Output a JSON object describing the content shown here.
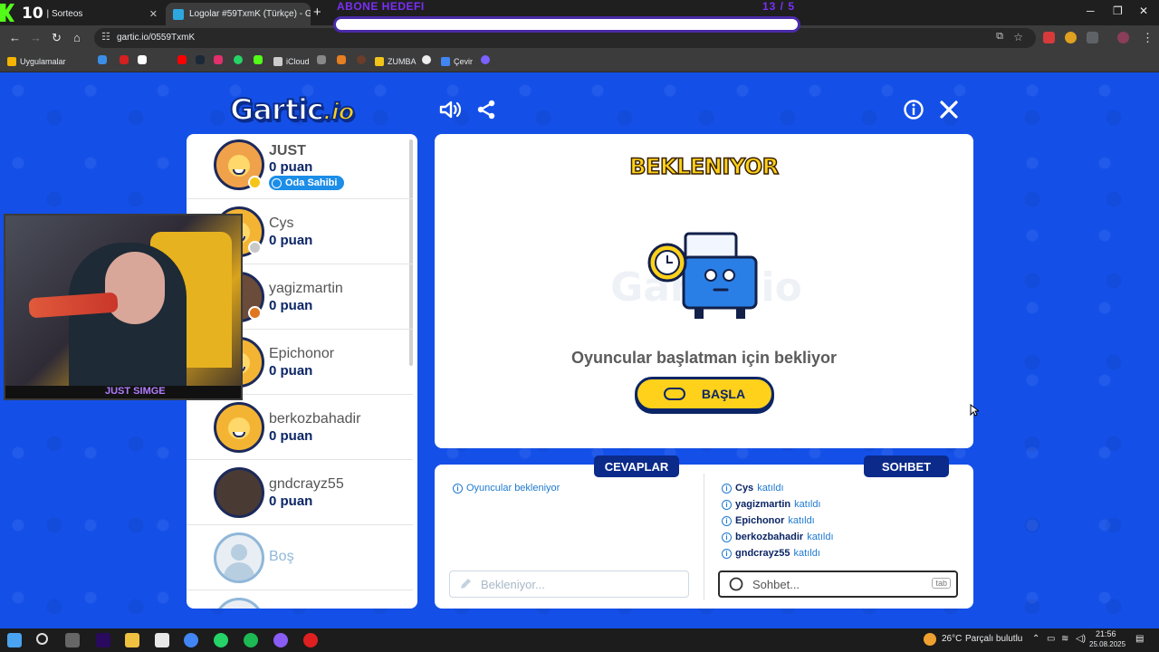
{
  "browser": {
    "tabs": [
      {
        "title": "otRix | Sorteos"
      },
      {
        "title": "Logolar #59TxmK (Türkçe) - Ga"
      }
    ],
    "overlay_number": "10",
    "url": "gartic.io/0559TxmK",
    "bookmarks": [
      "Uygulamalar",
      "iCloud",
      "ZUMBA",
      "Çevir"
    ]
  },
  "stream_goal": {
    "label": "ABONE HEDEFI",
    "count": "13 / 5"
  },
  "game": {
    "logo": {
      "main": "Gartic",
      "suffix": ".io"
    },
    "players": [
      {
        "name": "JUST",
        "points": "0 puan",
        "badge": "Oda Sahibi",
        "status_color": "#f5c518"
      },
      {
        "name": "Cys",
        "points": "0 puan",
        "status_color": "#c8c8c8"
      },
      {
        "name": "yagizmartin",
        "points": "0 puan",
        "status_color": "#e0761f"
      },
      {
        "name": "Epichonor",
        "points": "0 puan"
      },
      {
        "name": "berkozbahadir",
        "points": "0 puan"
      },
      {
        "name": "gndcrayz55",
        "points": "0 puan"
      },
      {
        "name": "Boş"
      }
    ],
    "webcam_tag": "JUST SIMGE",
    "status_title": "BEKLENIYOR",
    "status_message": "Oyuncular başlatman için bekliyor",
    "start_button": "BAŞLA",
    "answers": {
      "label": "CEVAPLAR",
      "lines": [
        "Oyuncular bekleniyor"
      ],
      "placeholder": "Bekleniyor..."
    },
    "chat": {
      "label": "SOHBET",
      "joined_suffix": "katıldı",
      "lines": [
        {
          "name": "Cys",
          "text": "katıldı"
        },
        {
          "name": "yagizmartin",
          "text": "katıldı"
        },
        {
          "name": "Epichonor",
          "text": "katıldı"
        },
        {
          "name": "berkozbahadir",
          "text": "katıldı"
        },
        {
          "name": "gndcrayz55",
          "text": "katıldı"
        }
      ],
      "placeholder": "Sohbet...",
      "tab_key": "tab"
    }
  },
  "taskbar": {
    "weather": "26°C",
    "weather_text": "Parçalı bulutlu",
    "time": "21:56",
    "date": "25.08.2025"
  },
  "colors": {
    "game_bg": "#1450e8",
    "accent_yellow": "#ffd11a",
    "navy": "#0b2566"
  }
}
